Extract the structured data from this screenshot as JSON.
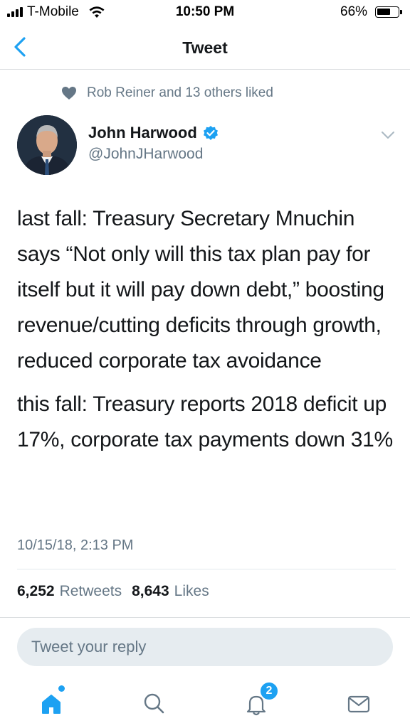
{
  "status_bar": {
    "carrier": "T-Mobile",
    "time": "10:50 PM",
    "battery_percent": "66%",
    "battery_level": 0.66
  },
  "nav": {
    "title": "Tweet"
  },
  "social_context": {
    "text": "Rob Reiner and 13 others liked"
  },
  "tweet": {
    "author_name": "John Harwood",
    "handle": "@JohnJHarwood",
    "verified": true,
    "paragraphs": [
      "last fall: Treasury Secretary Mnuchin says “Not only will this tax plan pay for itself but it will pay down debt,” boosting revenue/cutting deficits through growth, reduced corporate tax avoidance",
      "this fall: Treasury reports 2018 deficit up 17%, corporate tax payments down 31%"
    ],
    "timestamp": "10/15/18, 2:13 PM",
    "retweets_count": "6,252",
    "retweets_label": "Retweets",
    "likes_count": "8,643",
    "likes_label": "Likes"
  },
  "reply": {
    "placeholder": "Tweet your reply"
  },
  "tab_bar": {
    "notifications_badge": "2",
    "icons": [
      "home-icon",
      "search-icon",
      "notifications-icon",
      "messages-icon"
    ]
  },
  "colors": {
    "accent": "#1da1f2",
    "text_primary": "#14171a",
    "text_secondary": "#657786"
  }
}
